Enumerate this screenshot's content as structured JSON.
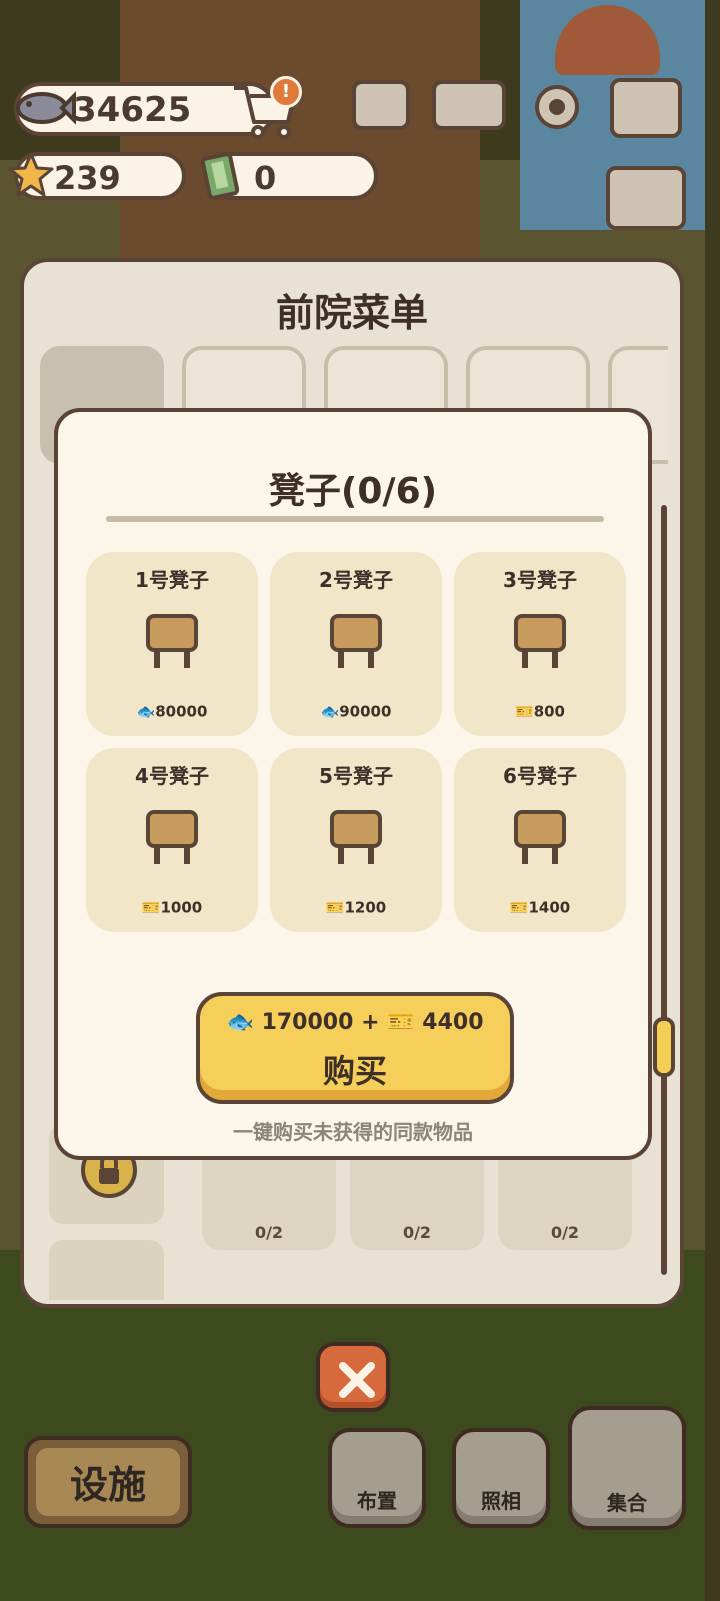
{
  "currency": {
    "fish": "34625",
    "stars": "239",
    "tickets": "0",
    "shop_alert": "!"
  },
  "panel": {
    "title": "前院菜单",
    "grid_counts": [
      "0/2",
      "0/2",
      "0/2"
    ]
  },
  "modal": {
    "title": "凳子(0/6)",
    "items": [
      {
        "name": "1号凳子",
        "price": "80000",
        "currency": "fish"
      },
      {
        "name": "2号凳子",
        "price": "90000",
        "currency": "fish"
      },
      {
        "name": "3号凳子",
        "price": "800",
        "currency": "ticket"
      },
      {
        "name": "4号凳子",
        "price": "1000",
        "currency": "ticket"
      },
      {
        "name": "5号凳子",
        "price": "1200",
        "currency": "ticket"
      },
      {
        "name": "6号凳子",
        "price": "1400",
        "currency": "ticket"
      }
    ],
    "buy": {
      "fish_cost": "170000",
      "plus": "+",
      "ticket_cost": "4400",
      "label": "购买"
    },
    "hint": "一键购买未获得的同款物品"
  },
  "bottom_nav": {
    "facilities": "设施",
    "layout": "布置",
    "photo": "照相",
    "gather": "集合"
  },
  "colors": {
    "accent_yellow": "#f5cf5a",
    "close_orange": "#d66a3c",
    "card_cream": "#f1e6c8",
    "outline_brown": "#5a4436"
  },
  "icons": {
    "fish": "fish-icon",
    "star": "star-icon",
    "ticket": "ticket-icon",
    "cart": "cart-icon",
    "close": "close-icon"
  }
}
